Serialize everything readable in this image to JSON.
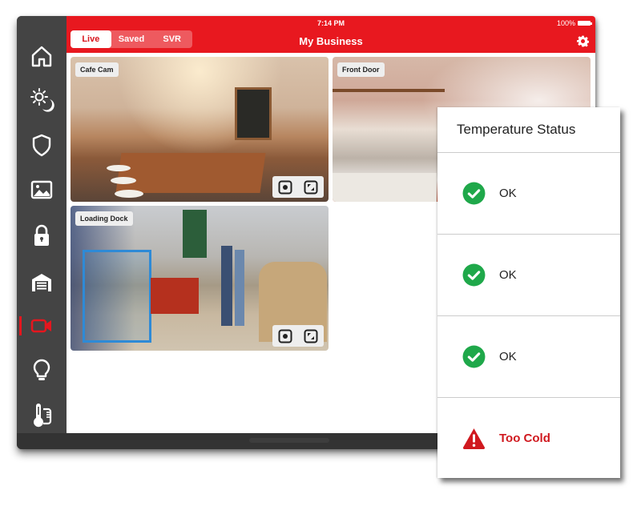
{
  "status_bar": {
    "time": "7:14 PM",
    "battery": "100%"
  },
  "header": {
    "title": "My Business",
    "tabs": [
      {
        "label": "Live",
        "active": true
      },
      {
        "label": "Saved",
        "active": false
      },
      {
        "label": "SVR",
        "active": false
      }
    ],
    "settings_icon": "gear-icon"
  },
  "sidebar": {
    "items": [
      {
        "name": "home",
        "icon": "home-icon",
        "active": false
      },
      {
        "name": "scenes",
        "icon": "sun-moon-icon",
        "active": false
      },
      {
        "name": "security",
        "icon": "shield-icon",
        "active": false
      },
      {
        "name": "images",
        "icon": "image-icon",
        "active": false
      },
      {
        "name": "locks",
        "icon": "lock-icon",
        "active": false
      },
      {
        "name": "garage",
        "icon": "garage-icon",
        "active": false
      },
      {
        "name": "video",
        "icon": "video-camera-icon",
        "active": true
      },
      {
        "name": "lights",
        "icon": "lightbulb-icon",
        "active": false
      },
      {
        "name": "thermostat",
        "icon": "thermometer-icon",
        "active": false
      }
    ]
  },
  "cameras": [
    {
      "label": "Cafe Cam"
    },
    {
      "label": "Front Door"
    },
    {
      "label": "Loading Dock"
    }
  ],
  "temperature_status": {
    "title": "Temperature Status",
    "rows": [
      {
        "status": "OK",
        "icon": "check-circle-icon",
        "alert": false
      },
      {
        "status": "OK",
        "icon": "check-circle-icon",
        "alert": false
      },
      {
        "status": "OK",
        "icon": "check-circle-icon",
        "alert": false
      },
      {
        "status": "Too Cold",
        "icon": "warning-triangle-icon",
        "alert": true
      }
    ]
  },
  "colors": {
    "brand_red": "#e8181f",
    "ok_green": "#1fa84a",
    "alert_red": "#d0191f",
    "sidebar_bg": "#444444"
  }
}
